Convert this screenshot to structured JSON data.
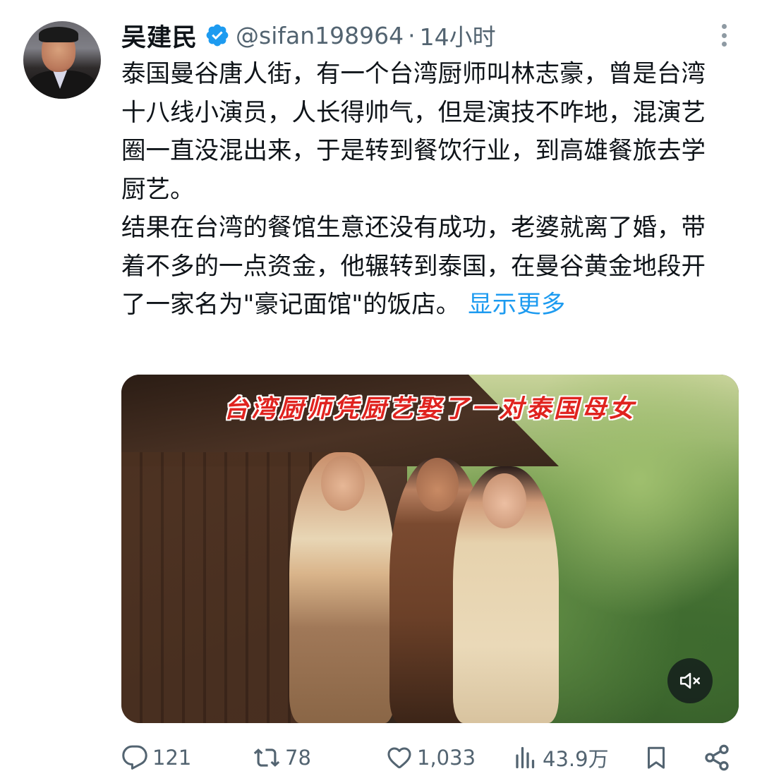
{
  "tweet": {
    "display_name": "吴建民",
    "handle": "@sifan198964",
    "separator": "·",
    "time": "14小时",
    "text_lines": [
      "泰国曼谷唐人街，有一个台湾厨师叫林志豪，曾是台湾十八线小演员，人长得帅气，但是演技不咋地，混演艺圈一直没混出来，于是转到餐饮行业，到高雄餐旅去学厨艺。",
      "结果在台湾的餐馆生意还没有成功，老婆就离了婚，带着不多的一点资金，他辗转到泰国，在曼谷黄金地段开了一家名为\"豪记面馆\"的饭店。"
    ],
    "show_more_label": "显示更多",
    "media": {
      "caption": "台湾厨师凭厨艺娶了一对泰国母女"
    },
    "actions": {
      "reply_count": "121",
      "retweet_count": "78",
      "like_count": "1,033",
      "view_count": "43.9万"
    }
  },
  "colors": {
    "text": "#0f1419",
    "secondary": "#536471",
    "link": "#1d9bf0",
    "verified": "#1d9bf0",
    "caption_red": "#e0231f"
  },
  "icons": {
    "verified": "verified-badge-icon",
    "more": "more-vertical-icon",
    "reply": "comment-bubble-icon",
    "retweet": "retweet-icon",
    "like": "heart-icon",
    "views": "bar-chart-icon",
    "bookmark": "bookmark-icon",
    "share": "share-icon",
    "mute": "speaker-muted-icon"
  }
}
